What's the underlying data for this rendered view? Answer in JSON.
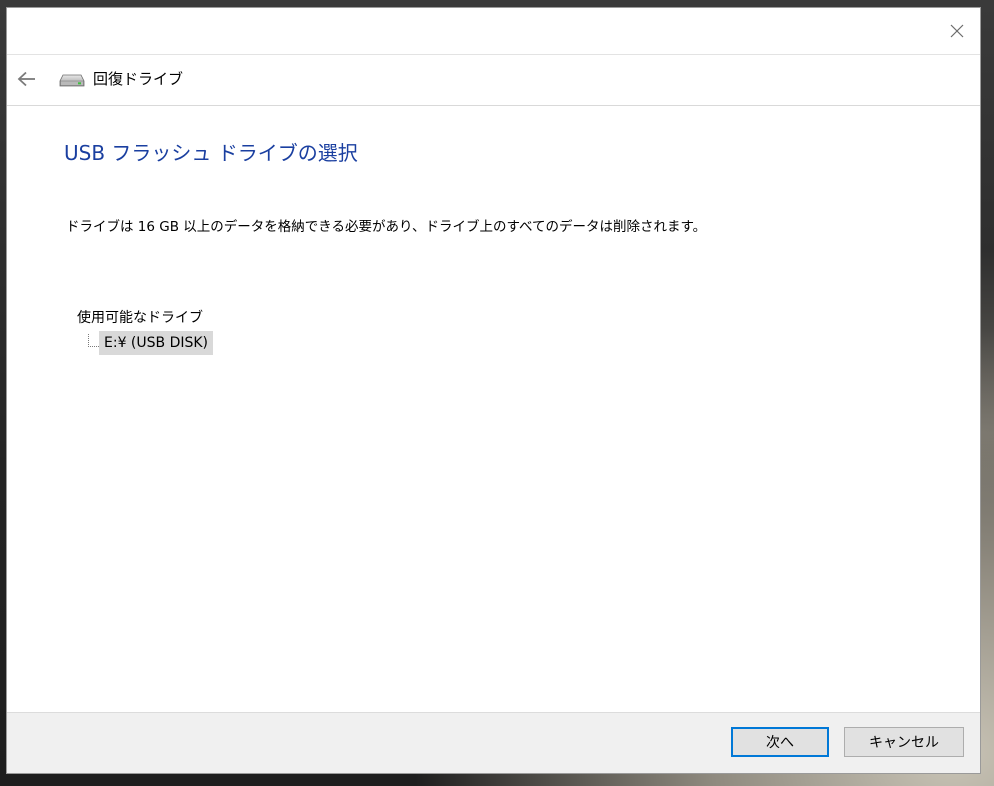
{
  "window": {
    "close_label": "Close"
  },
  "nav": {
    "title": "回復ドライブ"
  },
  "page": {
    "heading": "USB フラッシュ ドライブの選択",
    "description": "ドライブは 16 GB 以上のデータを格納できる必要があり、ドライブ上のすべてのデータは削除されます。",
    "drives_label": "使用可能なドライブ",
    "drives": [
      {
        "label": "E:¥ (USB DISK)",
        "selected": true
      }
    ]
  },
  "footer": {
    "next_label": "次へ",
    "cancel_label": "キャンセル"
  },
  "colors": {
    "heading": "#1a3fa0",
    "focus_border": "#0078d7",
    "selection": "#d9d9d9"
  }
}
